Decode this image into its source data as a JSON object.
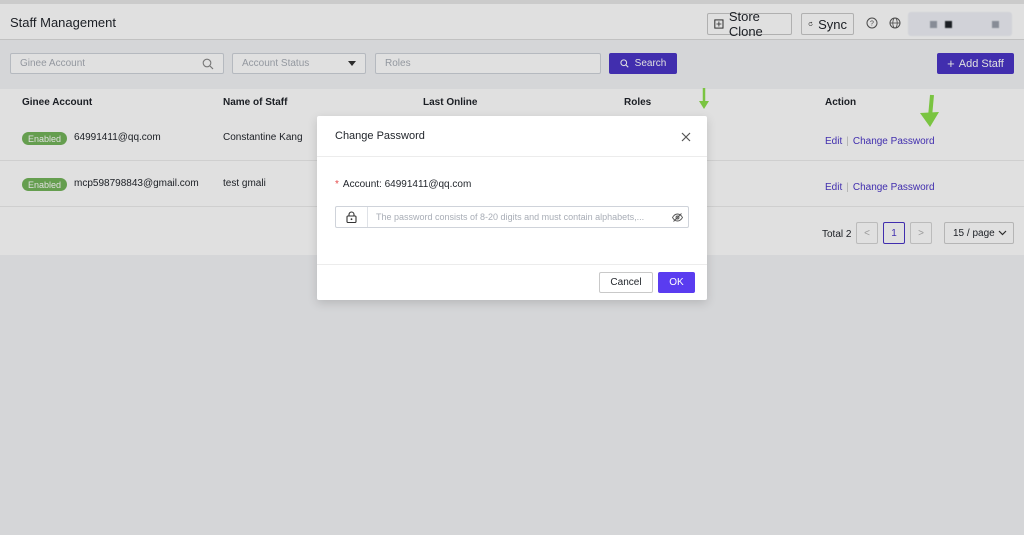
{
  "header": {
    "title": "Staff Management",
    "store_clone_label": "Store Clone",
    "sync_label": "Sync"
  },
  "filters": {
    "ginee_placeholder": "Ginee Account",
    "status_placeholder": "Account Status",
    "roles_placeholder": "Roles",
    "search_label": "Search",
    "add_staff_label": "Add Staff"
  },
  "table": {
    "columns": [
      "Ginee Account",
      "Name of Staff",
      "Last Online",
      "Roles",
      "Action"
    ],
    "rows": [
      {
        "status": "Enabled",
        "account": "64991411@qq.com",
        "name": "Constantine Kang",
        "edit": "Edit",
        "change_password": "Change Password"
      },
      {
        "status": "Enabled",
        "account": "mcp598798843@gmail.com",
        "name": "test gmali",
        "edit": "Edit",
        "change_password": "Change Password"
      }
    ]
  },
  "pagination": {
    "total": "Total 2",
    "prev": "<",
    "current": "1",
    "next": ">",
    "per_page": "15 / page"
  },
  "modal": {
    "title": "Change Password",
    "account_label": "Account: 64991411@qq.com",
    "password_placeholder": "The password consists of 8-20 digits and must contain alphabets,...",
    "cancel_label": "Cancel",
    "ok_label": "OK"
  },
  "colors": {
    "primary": "#4a35c7",
    "ok_button": "#5a3cf0",
    "enabled_badge": "#74b45a",
    "arrow": "#8be04a"
  }
}
